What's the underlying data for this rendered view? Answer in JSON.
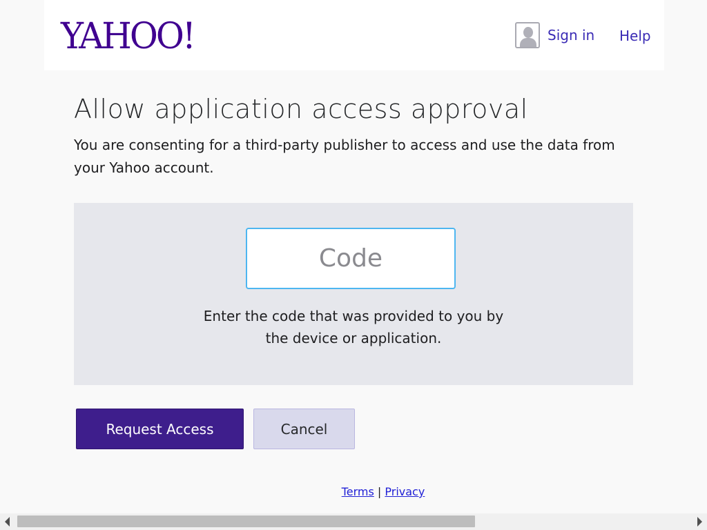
{
  "header": {
    "logo_text": "YAHOO!",
    "signin_label": "Sign in",
    "help_label": "Help",
    "user_icon": "user-silhouette-icon"
  },
  "main": {
    "title": "Allow application access approval",
    "description": "You are consenting for a third-party publisher to access and use the data from your Yahoo account.",
    "code_placeholder": "Code",
    "code_value": "",
    "hint": "Enter the code that was provided to you by the device or application."
  },
  "actions": {
    "request_label": "Request Access",
    "cancel_label": "Cancel"
  },
  "footer": {
    "terms_label": "Terms",
    "separator": "|",
    "privacy_label": "Privacy"
  },
  "colors": {
    "brand_purple": "#400090",
    "primary_button": "#3e1e8c",
    "secondary_button": "#d9d9ec",
    "link_blue": "#3a2bb5",
    "input_focus_border": "#4db6f0"
  }
}
